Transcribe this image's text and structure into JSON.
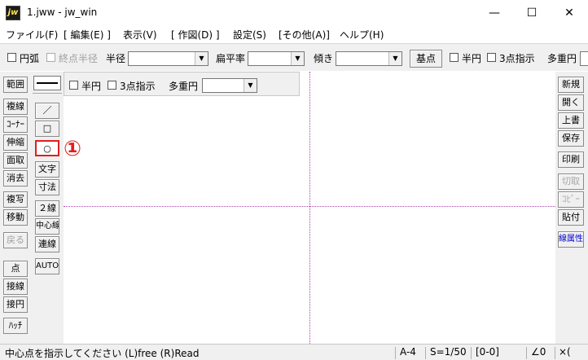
{
  "window": {
    "icon_text": "jw",
    "title": "1.jww - jw_win",
    "min": "—",
    "max": "☐",
    "close": "✕"
  },
  "menu": [
    "ファイル(F)",
    "[ 編集(E) ]",
    "表示(V)",
    "[ 作図(D) ]",
    "設定(S)",
    "[その他(A)]",
    "ヘルプ(H)"
  ],
  "toolbar": {
    "arc_label": "円弧",
    "end_radius_label": "終点半径",
    "radius_label": "半径",
    "flatness_label": "扁平率",
    "tilt_label": "傾き",
    "base_point_button": "基点",
    "half_circle_label": "半円",
    "three_point_label": "3点指示",
    "multi_circle_label": "多重円"
  },
  "subbar": {
    "half_circle_label": "半円",
    "three_point_label": "3点指示",
    "multi_circle_label": "多重円"
  },
  "left_tools_col1": [
    "範囲",
    "複線",
    "ｺｰﾅｰ",
    "伸縮",
    "面取",
    "消去",
    "複写",
    "移動",
    "戻る",
    "点",
    "接線",
    "接円",
    "ﾊｯﾁ"
  ],
  "left_tools_col2": {
    "line_glyph": "／",
    "rect_glyph": "□",
    "circle_glyph": "○",
    "text": "文字",
    "dim": "寸法",
    "double_line": "２線",
    "center_line": "中心線",
    "continuous_line": "連線",
    "auto": "AUTO"
  },
  "annotation_marker": "①",
  "right_tools": [
    "新規",
    "開く",
    "上書",
    "保存",
    "印刷",
    "切取",
    "ｺﾋﾟｰ",
    "貼付",
    "線属性"
  ],
  "status": {
    "message": "中心点を指示してください (L)free (R)Read",
    "paper": "A-4",
    "scale": "S=1/50",
    "layer": "[0-0]",
    "angle": "∠0",
    "extra": "×("
  },
  "colors": {
    "highlight": "#e02020",
    "guide_line": "#b040b0",
    "linetype_label": "#0000cc"
  }
}
